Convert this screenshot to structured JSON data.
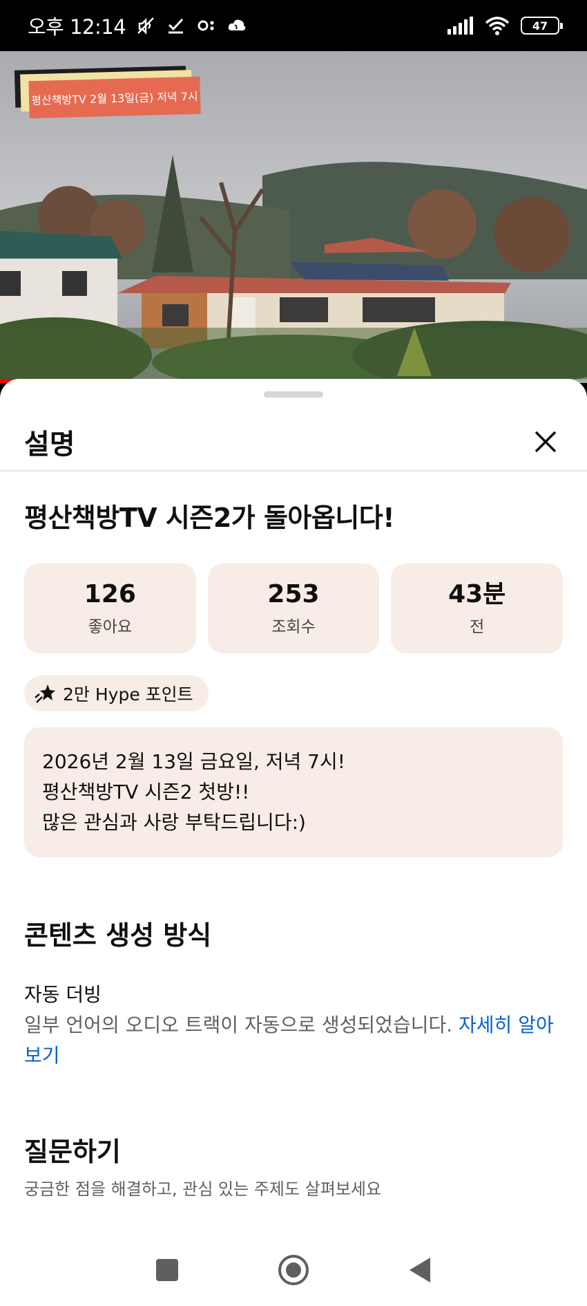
{
  "status_bar": {
    "time": "오후 12:14",
    "battery": "47"
  },
  "video": {
    "banner_text": "평산책방TV 2월 13일(금) 저녁 7시",
    "progress": 0.37
  },
  "sheet": {
    "title": "설명",
    "video_title": "평산책방TV 시즌2가 돌아옵니다!",
    "stats": [
      {
        "value": "126",
        "label": "좋아요"
      },
      {
        "value": "253",
        "label": "조회수"
      },
      {
        "value": "43분",
        "label": "전"
      }
    ],
    "hype": "2만 Hype 포인트",
    "description_lines": [
      "2026년 2월 13일 금요일, 저녁 7시!",
      "평산책방TV 시즌2 첫방!!",
      "많은 관심과 사랑 부탁드립니다:)"
    ],
    "content_method": {
      "heading": "콘텐츠 생성 방식",
      "item_title": "자동 더빙",
      "item_text": "일부 언어의 오디오 트랙이 자동으로 생성되었습니다.",
      "link": "자세히 알아보기"
    },
    "ask": {
      "heading": "질문하기",
      "subtitle": "궁금한 점을 해결하고, 관심 있는 주제도 살펴보세요"
    }
  },
  "colors": {
    "accent_link": "#065fd4",
    "chip_bg": "#f8ece6",
    "progress": "#ff0000"
  }
}
